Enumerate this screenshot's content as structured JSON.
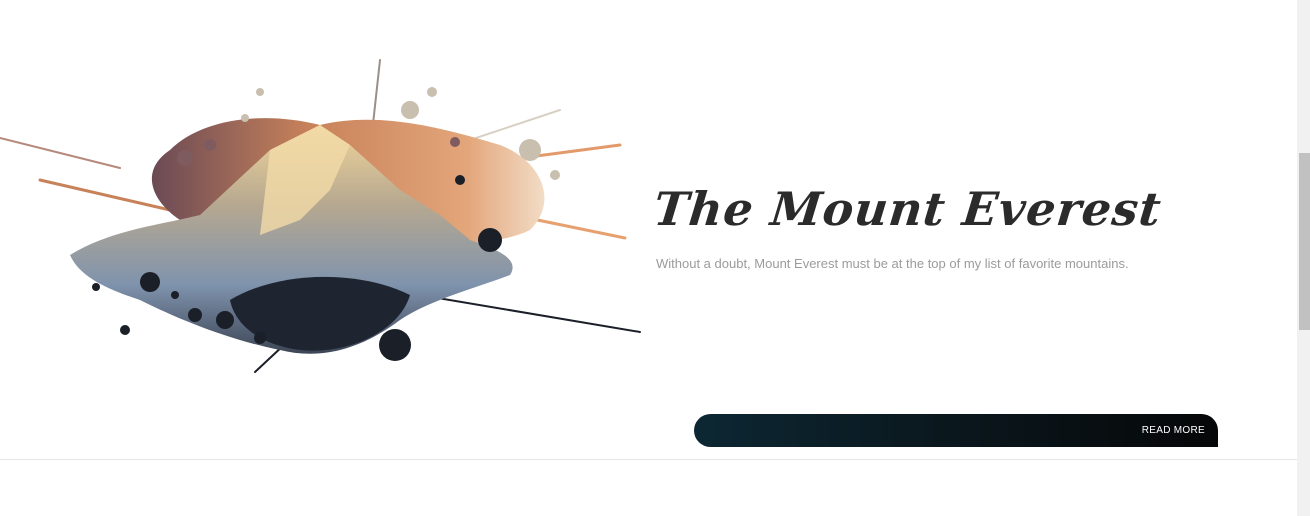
{
  "hero": {
    "title": "The Mount Everest",
    "description": "Without a doubt, Mount Everest must be at the top of my list of favorite mountains.",
    "cta_label": "READ MORE"
  },
  "image": {
    "subject": "mountain-splash-illustration",
    "colors": {
      "sky_warm": "#c8825a",
      "sky_dusk": "#6b4a55",
      "peak_light": "#e8c990",
      "rock_blue": "#7f93ad",
      "ink_dark": "#1a1f28"
    }
  },
  "colors": {
    "title": "#2b2b2b",
    "description": "#9b9b9b",
    "cta_gradient_start": "#0c2733",
    "cta_gradient_end": "#060708"
  }
}
